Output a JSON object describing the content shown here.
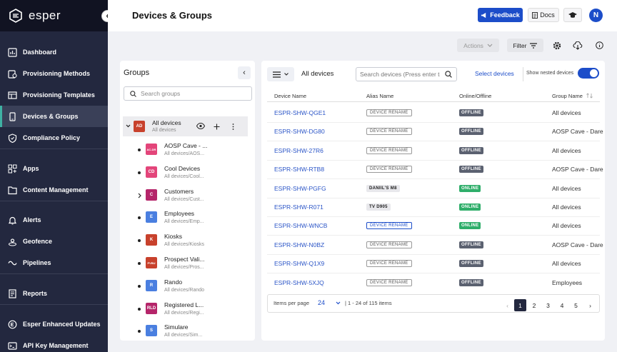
{
  "app": {
    "name": "esper"
  },
  "sidebar": {
    "items": [
      {
        "label": "Dashboard",
        "icon": "dashboard-icon"
      },
      {
        "label": "Provisioning Methods",
        "icon": "provisioning-icon"
      },
      {
        "label": "Provisioning Templates",
        "icon": "template-icon"
      },
      {
        "label": "Devices & Groups",
        "icon": "devices-icon",
        "active": true
      },
      {
        "label": "Compliance Policy",
        "icon": "shield-icon"
      },
      {
        "label": "Apps",
        "icon": "apps-icon"
      },
      {
        "label": "Content Management",
        "icon": "folder-icon"
      },
      {
        "label": "Alerts",
        "icon": "bell-icon"
      },
      {
        "label": "Geofence",
        "icon": "geofence-icon"
      },
      {
        "label": "Pipelines",
        "icon": "pipeline-icon"
      },
      {
        "label": "Reports",
        "icon": "report-icon"
      },
      {
        "label": "Esper Enhanced Updates",
        "icon": "update-icon"
      },
      {
        "label": "API Key Management",
        "icon": "terminal-icon"
      }
    ]
  },
  "header": {
    "title": "Devices & Groups",
    "feedback": "Feedback",
    "docs": "Docs",
    "user_initial": "N"
  },
  "toolbar": {
    "actions": "Actions",
    "filter": "Filter"
  },
  "groups": {
    "title": "Groups",
    "search_placeholder": "Search groups",
    "root": {
      "name": "All devices",
      "path": "All devices",
      "badge": "AD",
      "color": "#c8412c"
    },
    "items": [
      {
        "badge": "AC-DR",
        "name": "AOSP Cave - ...",
        "path": "All devices/AOS...",
        "color": "#e3457a"
      },
      {
        "badge": "CD",
        "name": "Cool Devices",
        "path": "All devices/Cool...",
        "color": "#e3457a"
      },
      {
        "badge": "C",
        "name": "Customers",
        "path": "All devices/Cust...",
        "color": "#b5256a",
        "expand": true
      },
      {
        "badge": "E",
        "name": "Employees",
        "path": "All devices/Emp...",
        "color": "#4a7fe0"
      },
      {
        "badge": "K",
        "name": "Kiosks",
        "path": "All devices/Kiosks",
        "color": "#c8412c"
      },
      {
        "badge": "PVBU",
        "name": "Prospect Vali...",
        "path": "All devices/Pros...",
        "color": "#c8412c"
      },
      {
        "badge": "R",
        "name": "Rando",
        "path": "All devices/Rando",
        "color": "#4a7fe0"
      },
      {
        "badge": "RLD",
        "name": "Registered L...",
        "path": "All devices/Regi...",
        "color": "#b5256a"
      },
      {
        "badge": "S",
        "name": "Simulare",
        "path": "All devices/Sim...",
        "color": "#4a7fe0"
      }
    ]
  },
  "devices": {
    "title": "All devices",
    "search_placeholder": "Search devices (Press enter to search)",
    "select_label": "Select devices",
    "nested_label": "Show nested devices",
    "columns": [
      "Device Name",
      "Alias Name",
      "Online/Offline",
      "Group Name"
    ],
    "rows": [
      {
        "name": "ESPR-SHW-QGE1",
        "alias": "DEVICE RENAME",
        "alias_style": "grey",
        "status": "OFFLINE",
        "group": "All devices"
      },
      {
        "name": "ESPR-SHW-DG80",
        "alias": "DEVICE RENAME",
        "alias_style": "grey",
        "status": "OFFLINE",
        "group": "AOSP Cave - Dare"
      },
      {
        "name": "ESPR-SHW-27R6",
        "alias": "DEVICE RENAME",
        "alias_style": "grey",
        "status": "OFFLINE",
        "group": "All devices"
      },
      {
        "name": "ESPR-SHW-RTB8",
        "alias": "DEVICE RENAME",
        "alias_style": "grey",
        "status": "OFFLINE",
        "group": "AOSP Cave - Dare"
      },
      {
        "name": "ESPR-SHW-PGFG",
        "alias": "DANIIL'S M8",
        "alias_style": "plain",
        "status": "ONLINE",
        "group": "All devices"
      },
      {
        "name": "ESPR-SHW-R071",
        "alias": "TV D905",
        "alias_style": "plain",
        "status": "ONLINE",
        "group": "All devices"
      },
      {
        "name": "ESPR-SHW-WNCB",
        "alias": "DEVICE RENAME",
        "alias_style": "blue",
        "status": "ONLINE",
        "group": "All devices"
      },
      {
        "name": "ESPR-SHW-N0BZ",
        "alias": "DEVICE RENAME",
        "alias_style": "grey",
        "status": "OFFLINE",
        "group": "AOSP Cave - Dare"
      },
      {
        "name": "ESPR-SHW-Q1X9",
        "alias": "DEVICE RENAME",
        "alias_style": "grey",
        "status": "OFFLINE",
        "group": "All devices"
      },
      {
        "name": "ESPR-SHW-5XJQ",
        "alias": "DEVICE RENAME",
        "alias_style": "grey",
        "status": "OFFLINE",
        "group": "Employees"
      }
    ],
    "pagination": {
      "items_per_page_label": "Items per page",
      "per_page": "24",
      "range": "| 1 - 24 of 115 items",
      "pages": [
        "1",
        "2",
        "3",
        "4",
        "5"
      ],
      "current": "1"
    }
  },
  "colors": {
    "online": "#2fae6a",
    "offline": "#5b6170",
    "accent": "#1c4dc9",
    "sidebar": "#23283f"
  }
}
